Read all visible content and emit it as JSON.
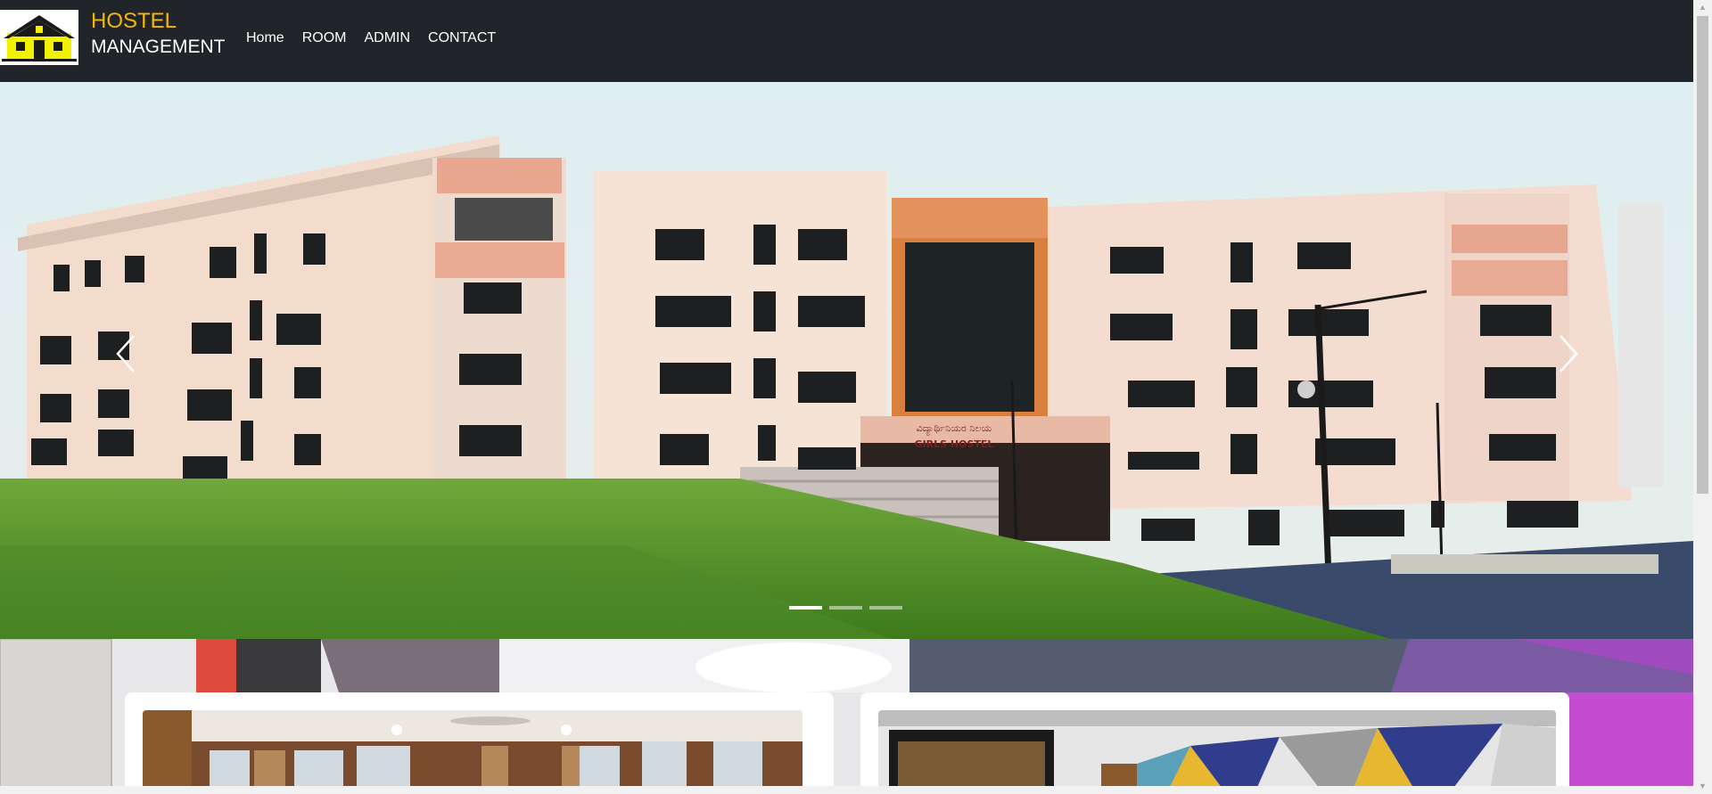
{
  "brand": {
    "line1": "HOSTEL",
    "line2": "MANAGEMENT",
    "accent_color": "#f5b800",
    "logo_icon": "house-logo-icon"
  },
  "nav": {
    "items": [
      {
        "label": "Home"
      },
      {
        "label": "ROOM"
      },
      {
        "label": "ADMIN"
      },
      {
        "label": "CONTACT"
      }
    ]
  },
  "carousel": {
    "building_sign": {
      "line1": "ವಿದ್ಯಾರ್ಥಿನಿಯರ ನಿಲಯ",
      "line2": "GIRLS HOSTEL"
    },
    "prev_icon": "chevron-left-icon",
    "next_icon": "chevron-right-icon",
    "active_slide": 1,
    "slide_count": 3
  },
  "colors": {
    "navbar": "#212529",
    "page_bg": "#ffffff"
  }
}
